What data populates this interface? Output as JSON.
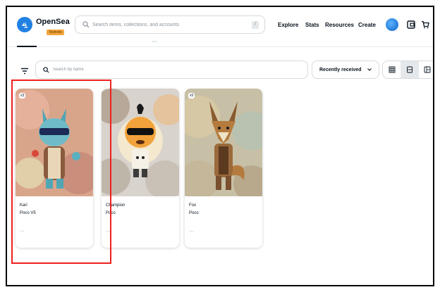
{
  "header": {
    "brand": "OpenSea",
    "badge": "Testnets",
    "search_placeholder": "Search items, collections, and accounts",
    "shortcut_key": "/",
    "nav": [
      "Explore",
      "Stats",
      "Resources",
      "Create"
    ]
  },
  "toolbar": {
    "name_search_placeholder": "Search by name",
    "sort_label": "Recently received"
  },
  "cards": [
    {
      "badge": "x3",
      "name": "Kari",
      "collection": "Poco V5",
      "more": "..."
    },
    {
      "badge": "",
      "name": "Champion",
      "collection": "Poco",
      "more": "..."
    },
    {
      "badge": "x5",
      "name": "Fox",
      "collection": "Poco",
      "more": "..."
    }
  ],
  "colors": {
    "brand_blue": "#2081e2",
    "highlight": "#ef1f1f"
  }
}
